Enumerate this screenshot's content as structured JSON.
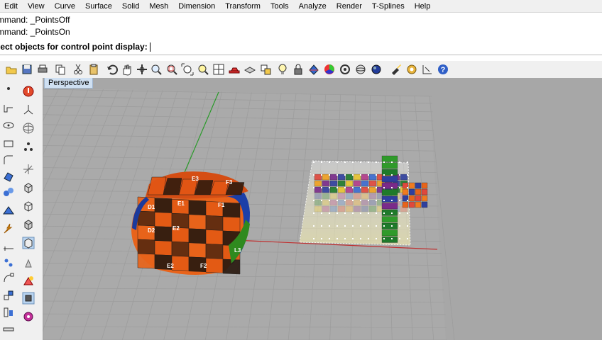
{
  "menu": [
    "Edit",
    "View",
    "Curve",
    "Surface",
    "Solid",
    "Mesh",
    "Dimension",
    "Transform",
    "Tools",
    "Analyze",
    "Render",
    "T-Splines",
    "Help"
  ],
  "command_history": [
    "mmand: _PointsOff",
    "mmand: _PointsOn"
  ],
  "command_prompt": "lect objects for control point display:",
  "viewport": {
    "label": "Perspective",
    "background": "#a7a7a7",
    "grid_color": "#9b9b9b"
  },
  "cube_labels": {
    "top": [
      "E3",
      "F3"
    ],
    "front_left": [
      "D1",
      "E1",
      "F1"
    ],
    "front_mid": [
      "D2",
      "E2"
    ],
    "front_bottom": [
      "E2",
      "F2"
    ],
    "right": [
      "L3"
    ]
  },
  "axes_colors": {
    "x": "#c03030",
    "y": "#2a9a2a"
  },
  "toolbar_icons": [
    "open-icon",
    "save-icon",
    "print-icon",
    "copy-icon",
    "cut-icon",
    "paste-icon",
    "undo-icon",
    "pan-hand-icon",
    "rotate-icon",
    "zoom-icon",
    "zoom-window-icon",
    "zoom-extents-icon",
    "zoom-selected-icon",
    "grid-icon",
    "car-icon",
    "layer-icon",
    "move-icon",
    "bulb-icon",
    "lock-icon",
    "paint-icon",
    "color-wheel-icon",
    "rings-icon",
    "sphere-icon",
    "sphere-dark-icon",
    "flashlight-icon",
    "settings-icon",
    "dimension-icon",
    "help-icon"
  ]
}
